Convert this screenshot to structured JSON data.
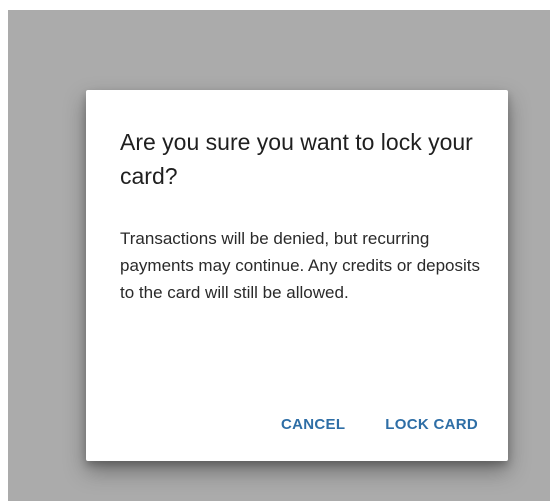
{
  "dialog": {
    "title": "Are you sure you want to lock your card?",
    "message": "Transactions will be denied, but recurring payments may continue. Any credits or deposits to the card will still be allowed.",
    "cancel_label": "CANCEL",
    "confirm_label": "LOCK CARD"
  },
  "colors": {
    "backdrop": "#ababab",
    "surface": "#ffffff",
    "accent": "#2e6ea6",
    "title_text": "#1f1f1f",
    "body_text": "#2a2a2a"
  }
}
